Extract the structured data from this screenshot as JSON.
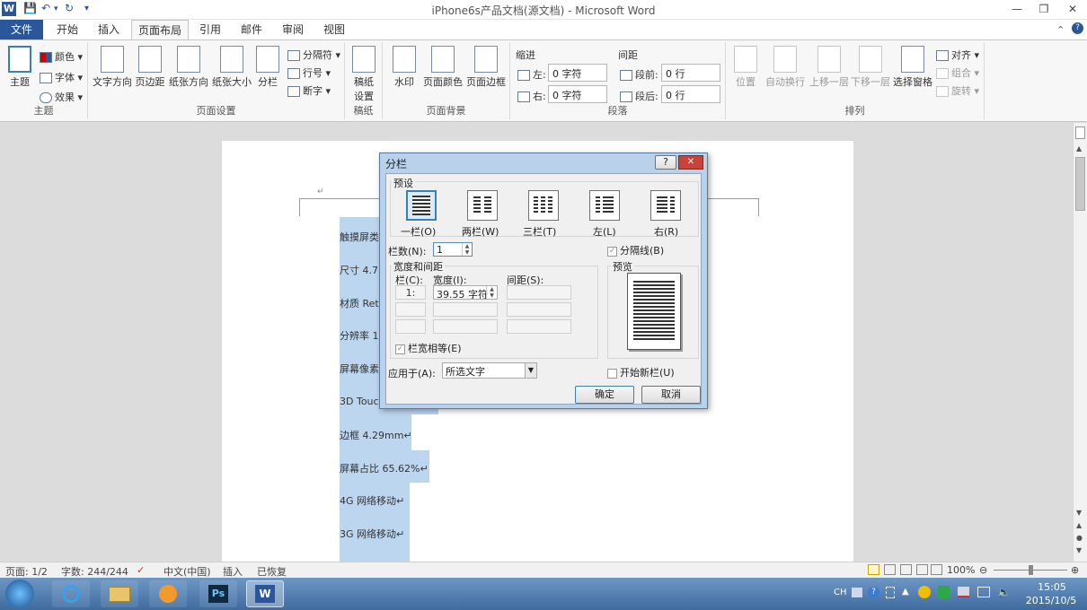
{
  "window": {
    "title": "iPhone6s产品文档(源文档) - Microsoft Word",
    "app_icon": "W",
    "quick_access": [
      "save-icon",
      "undo-icon",
      "redo-icon",
      "customize-icon"
    ],
    "controls": [
      "minimize-icon",
      "restore-icon",
      "close-icon"
    ]
  },
  "tabs": [
    {
      "label": "文件"
    },
    {
      "label": "开始"
    },
    {
      "label": "插入"
    },
    {
      "label": "页面布局"
    },
    {
      "label": "引用"
    },
    {
      "label": "邮件"
    },
    {
      "label": "审阅"
    },
    {
      "label": "视图"
    }
  ],
  "ribbon": {
    "theme": {
      "main": "主题",
      "colors": "颜色",
      "fonts": "字体",
      "effects": "效果",
      "group": "主题"
    },
    "page_setup": {
      "text_direction": "文字方向",
      "margins": "页边距",
      "orientation": "纸张方向",
      "size": "纸张大小",
      "columns": "分栏",
      "breaks": "分隔符",
      "line_numbers": "行号",
      "hyphenation": "断字",
      "group": "页面设置"
    },
    "draft": {
      "label": "稿纸\n设置",
      "group": "稿纸"
    },
    "background": {
      "watermark": "水印",
      "page_color": "页面颜色",
      "page_borders": "页面边框",
      "group": "页面背景"
    },
    "paragraph": {
      "indent": "缩进",
      "left": "左:",
      "left_value": "0 字符",
      "right": "右:",
      "right_value": "0 字符",
      "spacing": "间距",
      "before": "段前:",
      "before_value": "0 行",
      "after": "段后:",
      "after_value": "0 行",
      "group": "段落"
    },
    "arrange": {
      "position": "位置",
      "wrap": "自动换行",
      "forward": "上移一层",
      "backward": "下移一层",
      "selection_pane": "选择窗格",
      "align": "对齐",
      "group_btn": "组合",
      "rotate": "旋转",
      "group": "排列"
    }
  },
  "document": {
    "lines": [
      "触摸屏类",
      "尺寸 4.7",
      "材质 Ret",
      "分辨率 1",
      "屏幕像素",
      "3D Touch",
      "边框 4.29mm↵",
      "屏幕占比 65.62%↵",
      "4G 网络移动↵",
      "3G 网络移动↵"
    ],
    "para_mark": "↵"
  },
  "dialog": {
    "title": "分栏",
    "help": "?",
    "preset_label": "预设",
    "presets": [
      "一栏(O)",
      "两栏(W)",
      "三栏(T)",
      "左(L)",
      "右(R)"
    ],
    "num_columns_label": "栏数(N):",
    "num_columns_value": "1",
    "line_between": "分隔线(B)",
    "width_spacing_label": "宽度和间距",
    "col_header": "栏(C):",
    "width_header": "宽度(I):",
    "spacing_header": "间距(S):",
    "row1_col": "1:",
    "row1_width": "39.55 字符",
    "equal_width": "栏宽相等(E)",
    "apply_to_label": "应用于(A):",
    "apply_to_value": "所选文字",
    "preview_label": "预览",
    "start_new_column": "开始新栏(U)",
    "ok": "确定",
    "cancel": "取消"
  },
  "status_bar": {
    "page": "页面: 1/2",
    "words": "字数: 244/244",
    "language": "中文(中国)",
    "mode": "插入",
    "recovered": "已恢复",
    "zoom": "100%"
  },
  "taskbar": {
    "apps": [
      "start-orb-icon",
      "ie-icon",
      "explorer-icon",
      "media-player-icon",
      "photoshop-icon",
      "word-icon"
    ],
    "photoshop_label": "Ps",
    "word_label": "W",
    "tray_ime": "CH",
    "time": "15:05",
    "date": "2015/10/5"
  },
  "colors": {
    "accent": "#2b579a",
    "selection": "#bcd6ef",
    "dialog_frame": "#b9d1ea"
  }
}
